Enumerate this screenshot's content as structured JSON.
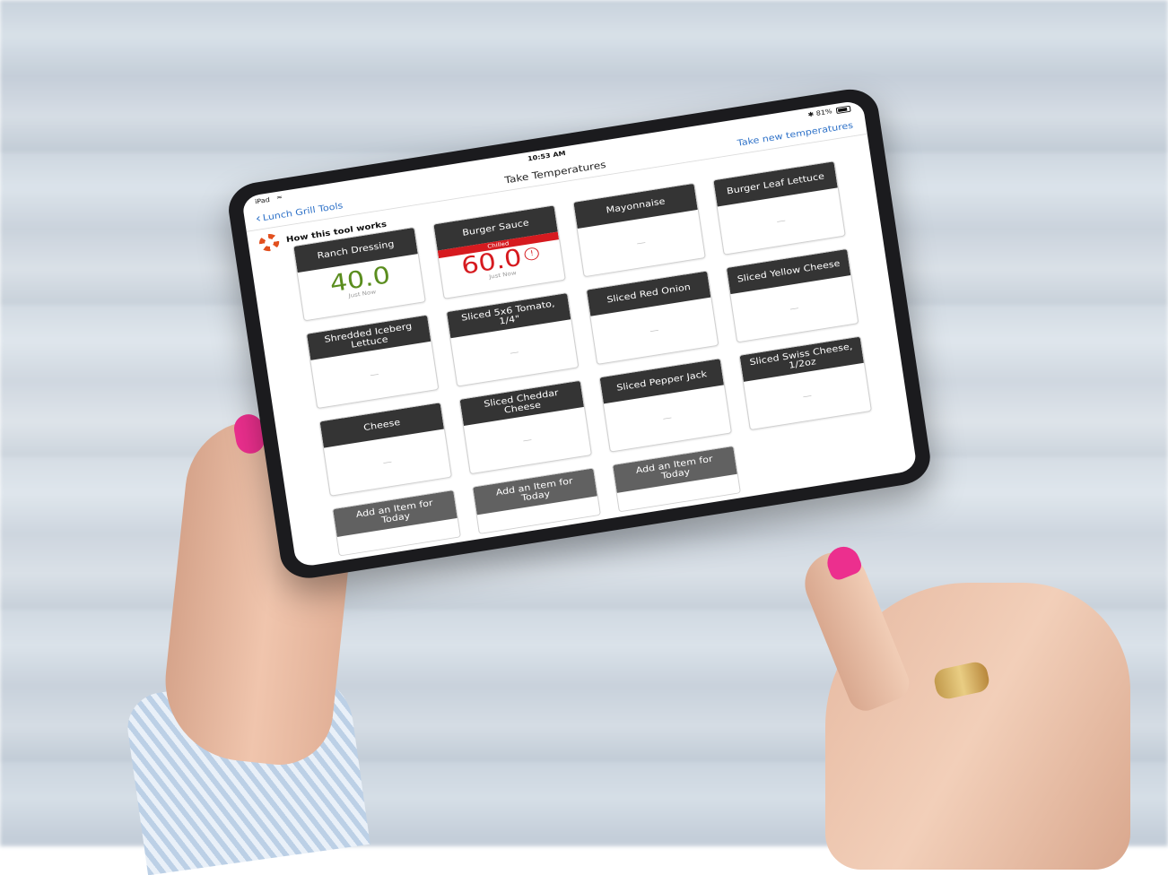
{
  "status": {
    "device": "iPad",
    "time": "10:53 AM",
    "battery": "81%",
    "bluetooth_icon": "bluetooth-icon",
    "wifi_icon": "wifi-icon"
  },
  "nav": {
    "back_label": "Lunch Grill Tools",
    "title": "Take Temperatures",
    "action_label": "Take new temperatures",
    "accent_color": "#2f72c8"
  },
  "howto": {
    "label": "How this tool works",
    "icon": "lifebuoy-icon"
  },
  "cards": [
    {
      "name": "Ranch Dressing",
      "value": "40.0",
      "time": "Just Now",
      "status": "ok"
    },
    {
      "name": "Burger Sauce",
      "flag": "Chilled",
      "value": "60.0",
      "time": "Just Now",
      "status": "alert"
    },
    {
      "name": "Mayonnaise",
      "value": "—"
    },
    {
      "name": "Burger Leaf Lettuce",
      "value": "—"
    },
    {
      "name": "Shredded Iceberg Lettuce",
      "value": "—"
    },
    {
      "name": "Sliced 5x6 Tomato, 1/4\"",
      "value": "—"
    },
    {
      "name": "Sliced Red Onion",
      "value": "—"
    },
    {
      "name": "Sliced Yellow Cheese",
      "value": "—"
    },
    {
      "name": "Cheese",
      "value": "—"
    },
    {
      "name": "Sliced Cheddar Cheese",
      "value": "—"
    },
    {
      "name": "Sliced Pepper Jack",
      "value": "—"
    },
    {
      "name": "Sliced Swiss Cheese, 1/2oz",
      "value": "—"
    }
  ],
  "add_items": [
    {
      "label": "Add an Item for Today"
    },
    {
      "label": "Add an Item for Today"
    },
    {
      "label": "Add an Item for Today"
    }
  ],
  "colors": {
    "ok": "#5a8d1e",
    "alert": "#d61a1f",
    "header": "#343434"
  }
}
